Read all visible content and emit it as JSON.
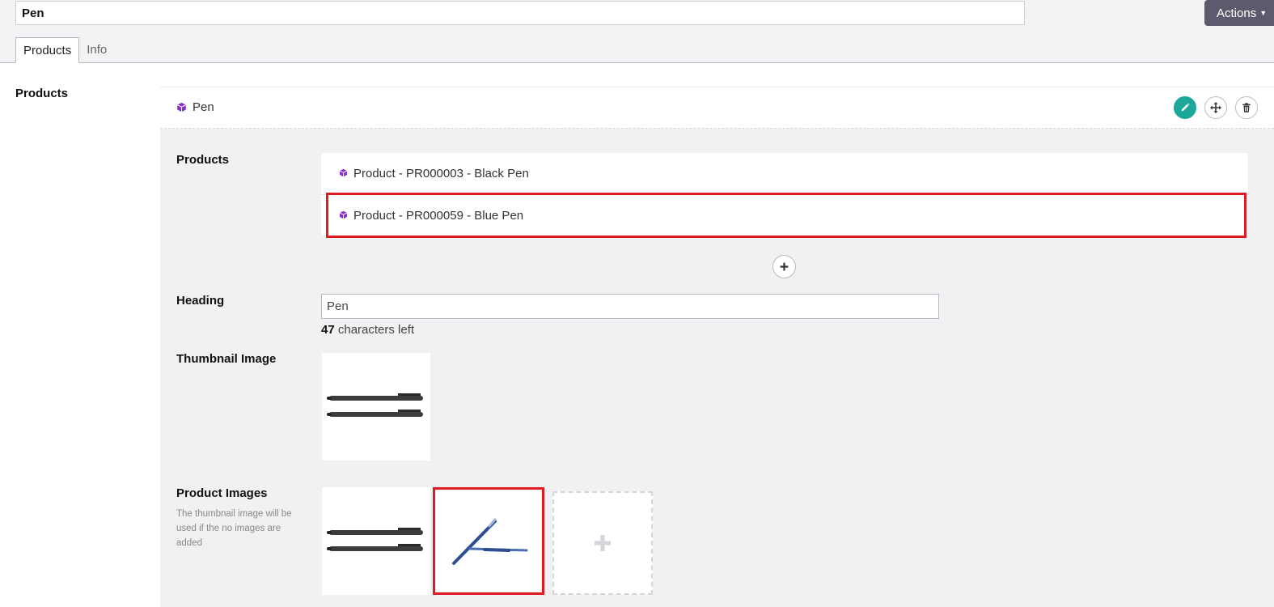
{
  "header": {
    "title_value": "Pen",
    "actions_label": "Actions"
  },
  "tabs": [
    {
      "label": "Products",
      "active": true
    },
    {
      "label": "Info",
      "active": false
    }
  ],
  "section_label": "Products",
  "block": {
    "title": "Pen",
    "icons": [
      "cube-icon",
      "edit-icon",
      "move-icon",
      "trash-icon"
    ],
    "fields": {
      "products_label": "Products",
      "products": [
        "Product - PR000003 - Black Pen",
        "Product - PR000059 - Blue Pen"
      ],
      "heading_label": "Heading",
      "heading_value": "Pen",
      "chars_left_count": "47",
      "chars_left_text": "characters left",
      "thumbnail_label": "Thumbnail Image",
      "product_images_label": "Product Images",
      "product_images_help": "The thumbnail image will be used if the no images are added"
    }
  },
  "colors": {
    "accent": "#1ba89a",
    "actions_bg": "#5e5a6e",
    "highlight": "#e01b24",
    "cube": "#8b2fc9"
  }
}
